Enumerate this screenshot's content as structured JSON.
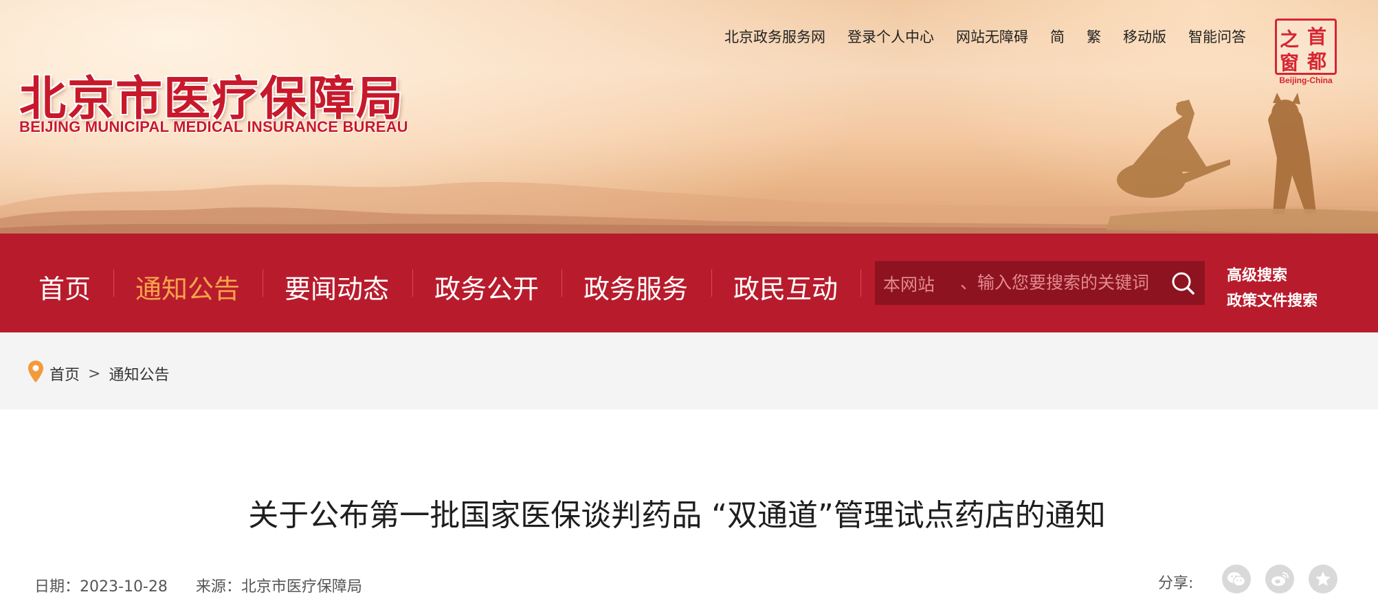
{
  "header": {
    "logo_cn": "北京市医疗保障局",
    "logo_en": "BEIJING MUNICIPAL MEDICAL INSURANCE BUREAU",
    "top_links": [
      "北京政务服务网",
      "登录个人中心",
      "网站无障碍",
      "简",
      "繁",
      "移动版",
      "智能问答"
    ],
    "seal": {
      "chars": [
        "之",
        "首",
        "窗",
        "都"
      ],
      "sub": "Beijing-China"
    }
  },
  "nav": {
    "items": [
      {
        "label": "首页",
        "active": false
      },
      {
        "label": "通知公告",
        "active": true
      },
      {
        "label": "要闻动态",
        "active": false
      },
      {
        "label": "政务公开",
        "active": false
      },
      {
        "label": "政务服务",
        "active": false
      },
      {
        "label": "政民互动",
        "active": false
      }
    ],
    "search": {
      "scope": "本网站",
      "placeholder": "、输入您要搜索的关键词"
    },
    "advanced_search": "高级搜索",
    "policy_search": "政策文件搜索"
  },
  "breadcrumb": {
    "home": "首页",
    "separator": ">",
    "current": "通知公告"
  },
  "article": {
    "title": "关于公布第一批国家医保谈判药品 “双通道”管理试点药店的通知",
    "date_label": "日期：",
    "date": "2023-10-28",
    "source_label": "来源：",
    "source": "北京市医疗保障局",
    "share_label": "分享:"
  },
  "colors": {
    "nav_bg": "#b81c2c",
    "active_nav": "#f7a34b",
    "brand_red": "#c8192b"
  }
}
